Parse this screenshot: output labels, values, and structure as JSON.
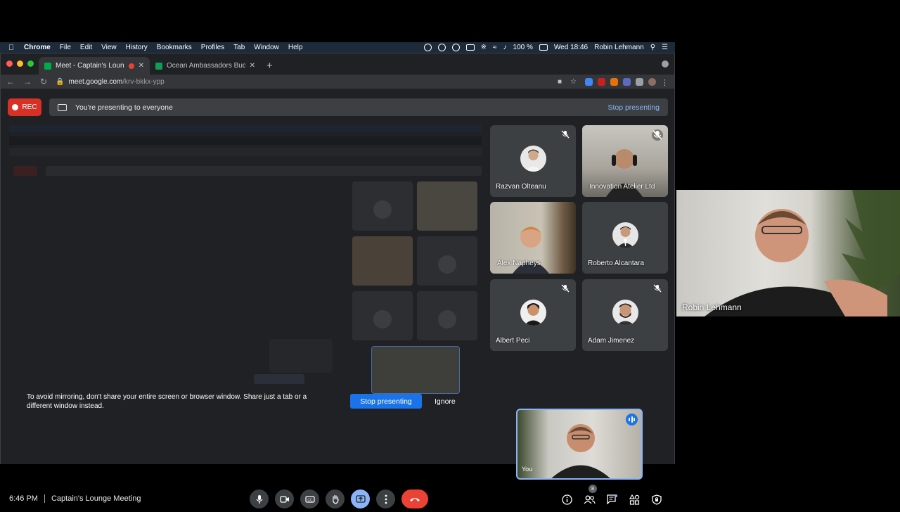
{
  "menubar": {
    "app": "Chrome",
    "items": [
      "File",
      "Edit",
      "View",
      "History",
      "Bookmarks",
      "Profiles",
      "Tab",
      "Window",
      "Help"
    ],
    "battery": "100 %",
    "datetime": "Wed 18:46",
    "user": "Robin Lehmann"
  },
  "tabs": [
    {
      "title": "Meet - Captain's Lounge M",
      "favicon": "meet-icon",
      "active": true
    },
    {
      "title": "Ocean Ambassadors Budget S",
      "favicon": "sheets-icon",
      "active": false
    }
  ],
  "toolbar": {
    "url_host": "meet.google.com",
    "url_path": "/krv-bkkx-ypp"
  },
  "meet": {
    "rec_label": "REC",
    "banner_text": "You're presenting to everyone",
    "stop_presenting": "Stop presenting",
    "hint": "To avoid mirroring, don't share your entire screen or browser window. Share just a tab or a different window instead.",
    "stop_btn": "Stop presenting",
    "ignore_btn": "Ignore",
    "time": "6:46 PM",
    "meeting_name": "Captain's Lounge Meeting",
    "participant_count": "8"
  },
  "participants": [
    {
      "name": "Razvan Olteanu",
      "muted": true
    },
    {
      "name": "Innovation Atelier Ltd",
      "muted": true
    },
    {
      "name": "Alex Napheys",
      "muted": false
    },
    {
      "name": "Roberto Alcantara",
      "muted": false
    },
    {
      "name": "Albert Peci",
      "muted": true
    },
    {
      "name": "Adam Jimenez",
      "muted": true
    }
  ],
  "self": {
    "name": "You"
  },
  "webcam": {
    "name": "Robin Lehmann"
  },
  "colors": {
    "accent": "#8ab4f8",
    "end_call": "#ea4335",
    "rec": "#d93025",
    "button": "#1a73e8"
  }
}
